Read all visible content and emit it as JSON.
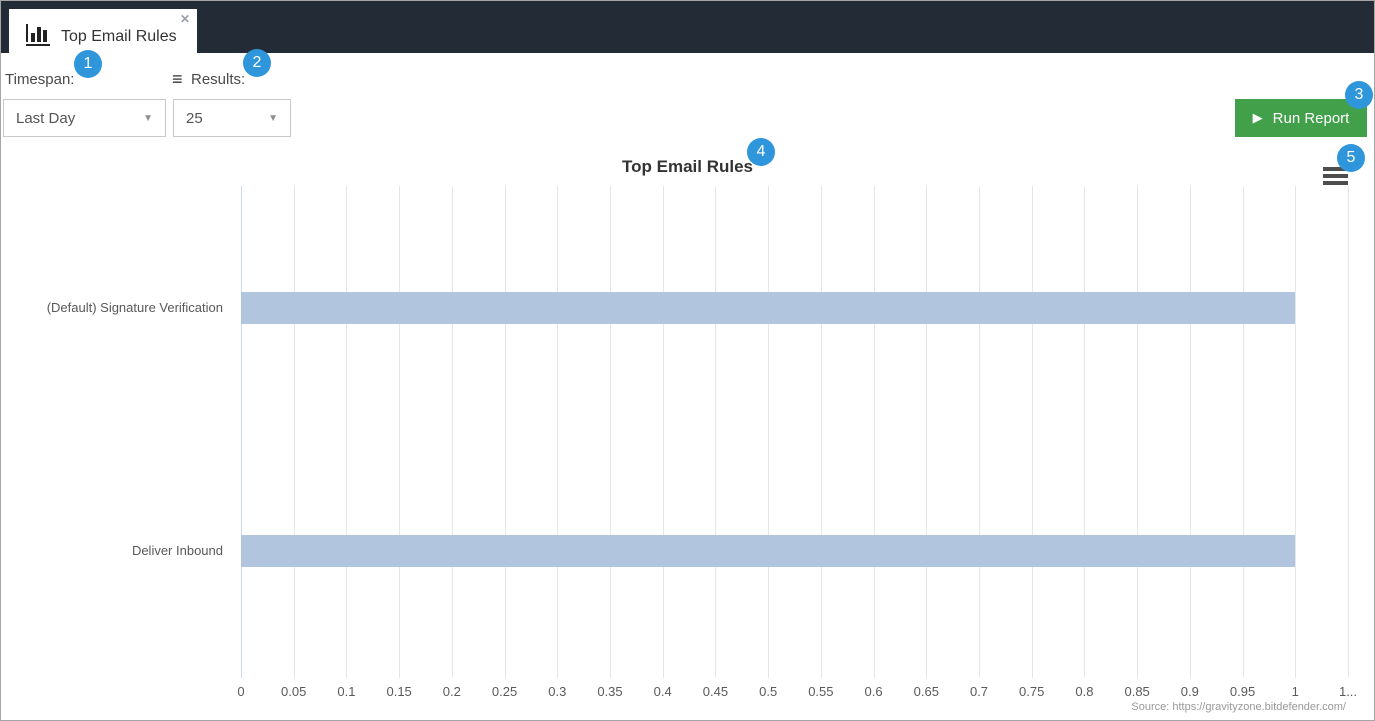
{
  "tab": {
    "title": "Top Email Rules",
    "close_icon": "✕",
    "icon": "bar-chart-icon"
  },
  "controls": {
    "timespan_label": "Timespan:",
    "timespan_value": "Last Day",
    "results_label": "Results:",
    "results_value": "25",
    "results_icon": "list-icon",
    "run_report_label": "Run Report",
    "run_report_icon": "play-icon"
  },
  "badges": [
    "1",
    "2",
    "3",
    "4",
    "5"
  ],
  "chart_data": {
    "type": "bar",
    "orientation": "horizontal",
    "title": "Top Email Rules",
    "categories": [
      "(Default) Signature Verification",
      "Deliver Inbound"
    ],
    "values": [
      1,
      1
    ],
    "xlim": [
      0,
      1.05
    ],
    "xtick_labels": [
      "0",
      "0.05",
      "0.1",
      "0.15",
      "0.2",
      "0.25",
      "0.3",
      "0.35",
      "0.4",
      "0.45",
      "0.5",
      "0.55",
      "0.6",
      "0.65",
      "0.7",
      "0.75",
      "0.8",
      "0.85",
      "0.9",
      "0.95",
      "1",
      "1..."
    ],
    "grid": true,
    "legend": "none",
    "bar_color": "#b1c5df",
    "source_note": "Source: https://gravityzone.bitdefender.com/"
  },
  "colors": {
    "header_bg": "#232b37",
    "badge_blue": "#2f96db",
    "button_green": "#41a049",
    "gridline": "#e6e6e6",
    "axis_line": "#ccd6eb"
  }
}
